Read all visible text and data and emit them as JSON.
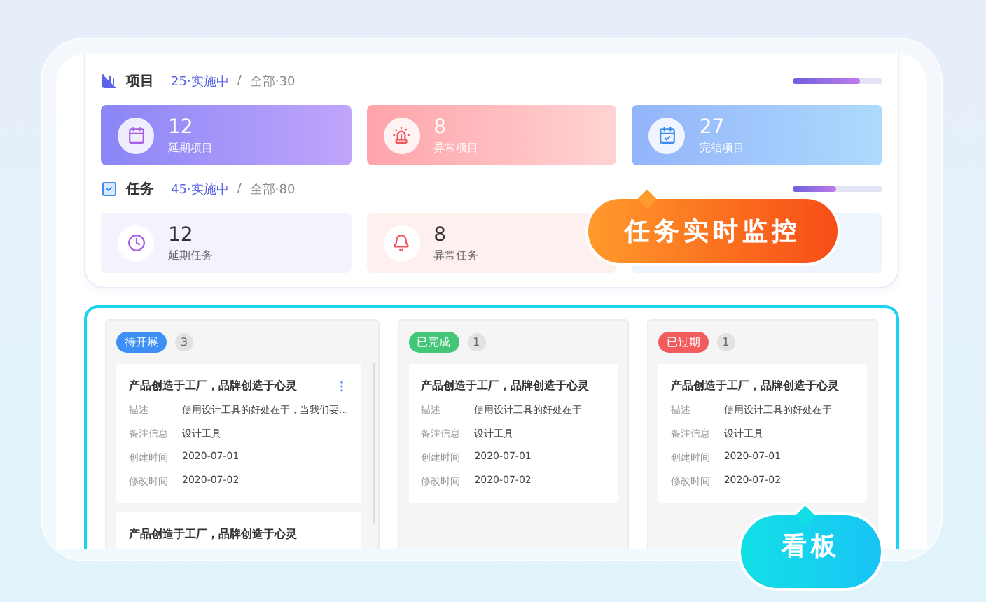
{
  "sections": [
    {
      "title": "项目",
      "active": "25·实施中",
      "separator": "/",
      "total": "全部·30",
      "level": 0.75,
      "stats": [
        {
          "kind": "delayed",
          "value": "12",
          "label": "延期项目"
        },
        {
          "kind": "abnormal",
          "value": "8",
          "label": "异常项目"
        },
        {
          "kind": "done",
          "value": "27",
          "label": "完结项目"
        }
      ]
    },
    {
      "title": "任务",
      "active": "45·实施中",
      "separator": "/",
      "total": "全部·80",
      "level": 0.48,
      "stats": [
        {
          "kind": "delayed",
          "value": "12",
          "label": "延期任务"
        },
        {
          "kind": "abnormal",
          "value": "8",
          "label": "异常任务"
        },
        {
          "kind": "done"
        }
      ]
    }
  ],
  "board": {
    "columns": [
      {
        "status": "待开展",
        "color": "#3d8ff5",
        "count": "3",
        "scrollable": true,
        "cards": [
          {
            "title": "产品创造于工厂，品牌创造于心灵",
            "menu": true,
            "fields": [
              {
                "label": "描述",
                "value": "使用设计工具的好处在于，当我们要..."
              },
              {
                "label": "备注信息",
                "value": "设计工具"
              },
              {
                "label": "创建时间",
                "value": "2020-07-01"
              },
              {
                "label": "修改时间",
                "value": "2020-07-02"
              }
            ]
          },
          {
            "title": "产品创造于工厂，品牌创造于心灵",
            "menu": false
          }
        ]
      },
      {
        "status": "已完成",
        "color": "#43c677",
        "count": "1",
        "scrollable": false,
        "cards": [
          {
            "title": "产品创造于工厂，品牌创造于心灵",
            "menu": false,
            "fields": [
              {
                "label": "描述",
                "value": "使用设计工具的好处在于"
              },
              {
                "label": "备注信息",
                "value": "设计工具"
              },
              {
                "label": "创建时间",
                "value": "2020-07-01"
              },
              {
                "label": "修改时间",
                "value": "2020-07-02"
              }
            ]
          }
        ]
      },
      {
        "status": "已过期",
        "color": "#f25c5c",
        "count": "1",
        "scrollable": false,
        "cards": [
          {
            "title": "产品创造于工厂，品牌创造于心灵",
            "menu": false,
            "fields": [
              {
                "label": "描述",
                "value": "使用设计工具的好处在于"
              },
              {
                "label": "备注信息",
                "value": "设计工具"
              },
              {
                "label": "创建时间",
                "value": "2020-07-01"
              },
              {
                "label": "修改时间",
                "value": "2020-07-02"
              }
            ]
          }
        ]
      }
    ]
  },
  "callouts": [
    {
      "kind": "orange",
      "text": "任务实时监控"
    },
    {
      "kind": "cyan",
      "text": "看板"
    }
  ]
}
